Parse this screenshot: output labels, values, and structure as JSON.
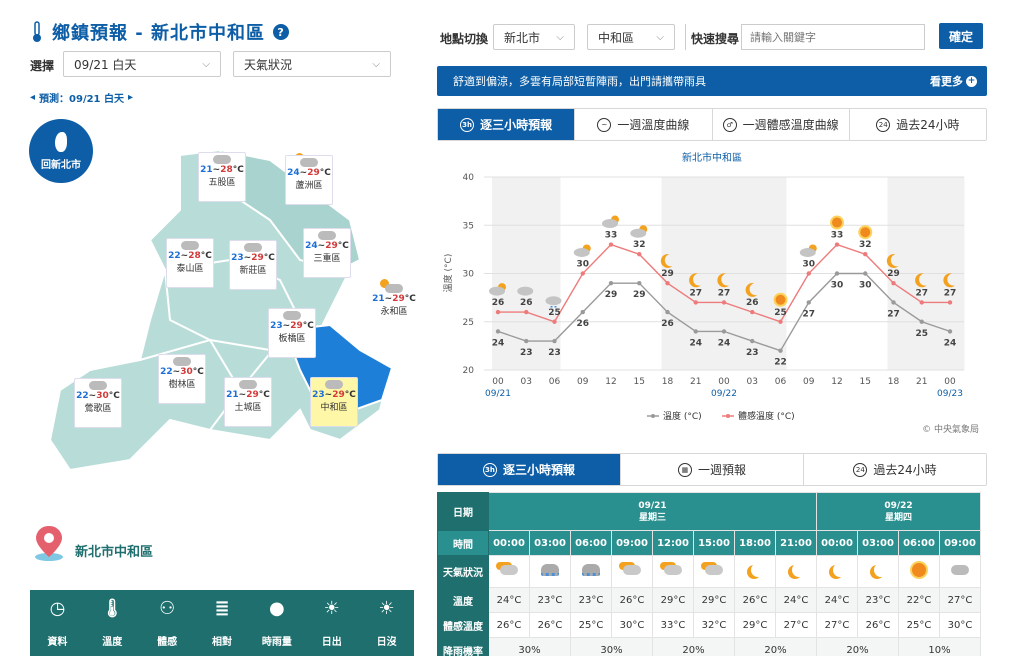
{
  "title": "鄉鎮預報 - 新北市中和區",
  "help": "?",
  "select_label": "選擇",
  "period_select": "09/21 白天",
  "type_select": "天氣狀況",
  "forecast_nav": "預測：09/21 白天",
  "back_btn": "回新北市",
  "location_label": "地點切換",
  "city_select": "新北市",
  "district_select": "中和區",
  "search_label": "快速搜尋",
  "search_placeholder": "請輸入關鍵字",
  "confirm": "確定",
  "banner_text": "舒適到偏涼，多雲有局部短暫陣雨，出門請攜帶雨具",
  "see_more": "看更多",
  "tabs_top": [
    {
      "label": "逐三小時預報",
      "icon": "3h-icon"
    },
    {
      "label": "一週溫度曲線",
      "icon": "thermometer-week-icon"
    },
    {
      "label": "一週體感溫度曲線",
      "icon": "person-temp-icon"
    },
    {
      "label": "過去24小時",
      "icon": "24h-icon"
    }
  ],
  "tabs_bottom": [
    {
      "label": "逐三小時預報"
    },
    {
      "label": "一週預報"
    },
    {
      "label": "過去24小時"
    }
  ],
  "districts": [
    {
      "name": "五股區",
      "range": "21~28°C"
    },
    {
      "name": "蘆洲區",
      "range": "24~29°C"
    },
    {
      "name": "泰山區",
      "range": "22~28°C"
    },
    {
      "name": "新莊區",
      "range": "23~29°C"
    },
    {
      "name": "三重區",
      "range": "24~29°C"
    },
    {
      "name": "永和區",
      "range": "21~29°C"
    },
    {
      "name": "板橋區",
      "range": "23~29°C"
    },
    {
      "name": "樹林區",
      "range": "22~30°C"
    },
    {
      "name": "鶯歌區",
      "range": "22~30°C"
    },
    {
      "name": "土城區",
      "range": "21~29°C"
    },
    {
      "name": "中和區",
      "range": "23~29°C"
    }
  ],
  "location_name": "新北市中和區",
  "icon_cells": [
    "資料",
    "溫度",
    "體感",
    "相對",
    "時雨量",
    "日出",
    "日沒"
  ],
  "chart_data": {
    "type": "line",
    "title": "新北市中和區",
    "ylabel": "溫度 (°C)",
    "ylim": [
      20,
      40
    ],
    "yticks": [
      20,
      25,
      30,
      35,
      40
    ],
    "x": [
      "00",
      "03",
      "06",
      "09",
      "12",
      "15",
      "18",
      "21",
      "00",
      "03",
      "06",
      "09",
      "12",
      "15",
      "18",
      "21",
      "00"
    ],
    "date_labels": [
      {
        "i": 0,
        "t": "09/21"
      },
      {
        "i": 8,
        "t": "09/22"
      },
      {
        "i": 16,
        "t": "09/23"
      }
    ],
    "series": [
      {
        "name": "溫度 (°C)",
        "color": "#9a9a9a",
        "values": [
          24,
          23,
          23,
          26,
          29,
          29,
          26,
          24,
          24,
          23,
          22,
          27,
          30,
          30,
          27,
          25,
          24
        ]
      },
      {
        "name": "體感溫度 (°C)",
        "color": "#ee7b7b",
        "values": [
          26,
          26,
          25,
          30,
          33,
          32,
          29,
          27,
          27,
          26,
          25,
          30,
          33,
          32,
          29,
          27,
          27
        ]
      }
    ],
    "icons": [
      "cloud-sun",
      "cloud",
      "cloud-rain",
      "cloud-sun",
      "cloud-sun",
      "cloud-sun",
      "moon",
      "moon",
      "moon",
      "moon",
      "sun",
      "cloud-sun",
      "sun",
      "sun",
      "moon",
      "moon",
      "moon"
    ],
    "credit": "© 中央氣象局"
  },
  "table": {
    "row_date": "日期",
    "row_time": "時間",
    "row_weather": "天氣狀況",
    "row_temp": "溫度",
    "row_feel": "體感溫度",
    "row_rain": "降雨機率",
    "days": [
      {
        "date": "09/21",
        "week": "星期三"
      },
      {
        "date": "09/22",
        "week": "星期四"
      }
    ],
    "times": [
      "00:00",
      "03:00",
      "06:00",
      "09:00",
      "12:00",
      "15:00",
      "18:00",
      "21:00",
      "00:00",
      "03:00",
      "06:00",
      "09:00"
    ],
    "weather": [
      "clsun",
      "clrain",
      "clrain",
      "clsun",
      "clsun",
      "clsun",
      "moon",
      "moon",
      "moon",
      "moon",
      "sunic",
      "cl"
    ],
    "temps": [
      "24°C",
      "23°C",
      "23°C",
      "26°C",
      "29°C",
      "29°C",
      "26°C",
      "24°C",
      "24°C",
      "23°C",
      "22°C",
      "27°C"
    ],
    "feels": [
      "26°C",
      "26°C",
      "25°C",
      "30°C",
      "33°C",
      "32°C",
      "29°C",
      "27°C",
      "27°C",
      "26°C",
      "25°C",
      "30°C"
    ],
    "rain": [
      "30%",
      "30%",
      "20%",
      "20%",
      "20%",
      "10%"
    ]
  }
}
